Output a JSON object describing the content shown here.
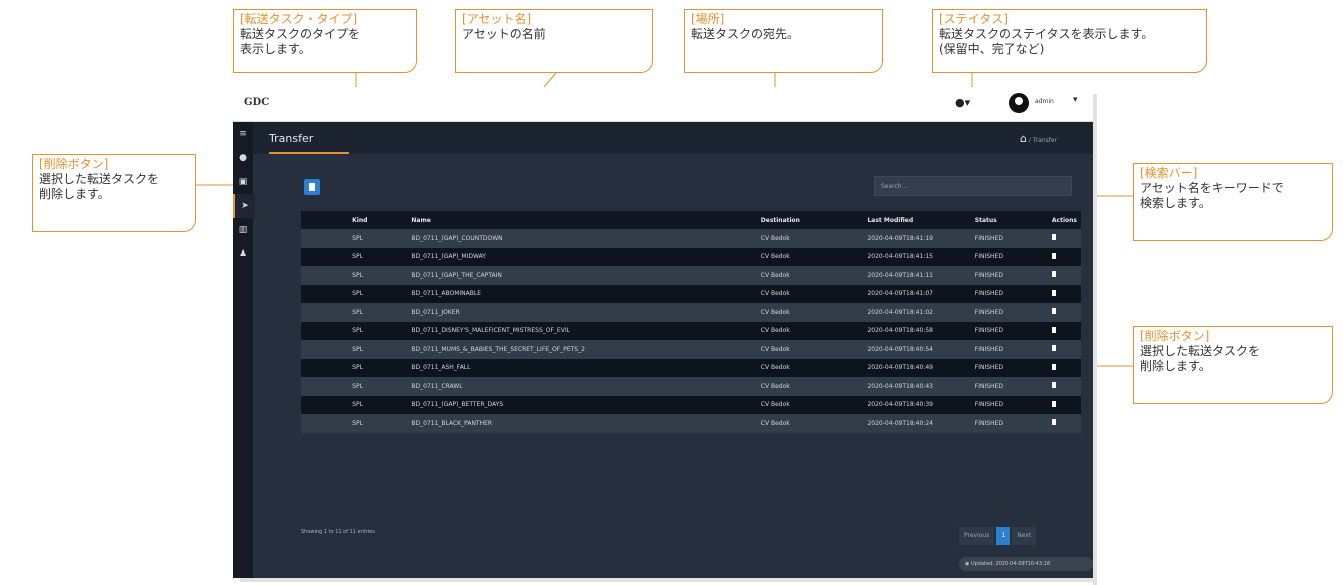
{
  "callouts": {
    "kind": {
      "title": "[転送タスク・タイプ]",
      "lines": [
        "転送タスクのタイプを",
        "表示します。"
      ]
    },
    "name": {
      "title": "[アセット名]",
      "lines": [
        "アセットの名前"
      ]
    },
    "destination": {
      "title": "[場所]",
      "lines": [
        "転送タスクの宛先。"
      ]
    },
    "status": {
      "title": "[ステイタス]",
      "lines": [
        "転送タスクのステイタスを表示します。",
        "(保留中、完了など)"
      ]
    },
    "delete_left": {
      "title": "[削除ボタン]",
      "lines": [
        "選択した転送タスクを",
        "削除します。"
      ]
    },
    "search": {
      "title": "[検索バー]",
      "lines": [
        "アセット名をキーワードで",
        "検索します。"
      ]
    },
    "delete_right": {
      "title": "[削除ボタン]",
      "lines": [
        "選択した転送タスクを",
        "削除します。"
      ]
    }
  },
  "app": {
    "logo": "GDC",
    "help_icon": "help-icon",
    "user": "admin",
    "page_title": "Transfer",
    "breadcrumb": "/ Transfer",
    "search_placeholder": "Search...",
    "columns": {
      "kind": "Kind",
      "name": "Name",
      "destination": "Destination",
      "last_modified": "Last Modified",
      "status": "Status",
      "actions": "Actions"
    },
    "rows": [
      {
        "kind": "SPL",
        "name": "BD_0711_(GAP)_COUNTDOWN",
        "destination": "CV Bedok",
        "last_modified": "2020-04-09T18:41:19",
        "status": "FINISHED"
      },
      {
        "kind": "SPL",
        "name": "BD_0711_(GAP)_MIDWAY",
        "destination": "CV Bedok",
        "last_modified": "2020-04-09T18:41:15",
        "status": "FINISHED"
      },
      {
        "kind": "SPL",
        "name": "BD_0711_(GAP)_THE_CAPTAIN",
        "destination": "CV Bedok",
        "last_modified": "2020-04-09T18:41:11",
        "status": "FINISHED"
      },
      {
        "kind": "SPL",
        "name": "BD_0711_ABOMINABLE",
        "destination": "CV Bedok",
        "last_modified": "2020-04-09T18:41:07",
        "status": "FINISHED"
      },
      {
        "kind": "SPL",
        "name": "BD_0711_JOKER",
        "destination": "CV Bedok",
        "last_modified": "2020-04-09T18:41:02",
        "status": "FINISHED"
      },
      {
        "kind": "SPL",
        "name": "BD_0711_DISNEY'S_MALEFICENT_MISTRESS_OF_EVIL",
        "destination": "CV Bedok",
        "last_modified": "2020-04-09T18:40:58",
        "status": "FINISHED"
      },
      {
        "kind": "SPL",
        "name": "BD_0711_MUMS_&_BABIES_THE_SECRET_LIFE_OF_PETS_2",
        "destination": "CV Bedok",
        "last_modified": "2020-04-09T18:40:54",
        "status": "FINISHED"
      },
      {
        "kind": "SPL",
        "name": "BD_0711_ASH_FALL",
        "destination": "CV Bedok",
        "last_modified": "2020-04-09T18:40:49",
        "status": "FINISHED"
      },
      {
        "kind": "SPL",
        "name": "BD_0711_CRAWL",
        "destination": "CV Bedok",
        "last_modified": "2020-04-09T18:40:43",
        "status": "FINISHED"
      },
      {
        "kind": "SPL",
        "name": "BD_0711_(GAP)_BETTER_DAYS",
        "destination": "CV Bedok",
        "last_modified": "2020-04-09T18:40:39",
        "status": "FINISHED"
      },
      {
        "kind": "SPL",
        "name": "BD_0711_BLACK_PANTHER",
        "destination": "CV Bedok",
        "last_modified": "2020-04-09T18:40:24",
        "status": "FINISHED"
      }
    ],
    "entries_info": "Showing 1 to 11 of 11 entries",
    "pager": {
      "previous": "Previous",
      "current": "1",
      "next": "Next"
    },
    "updated": "Updated: 2020-04-09T10:43:18",
    "accent_color": "#e8912d",
    "primary_color": "#2f7fd0"
  }
}
